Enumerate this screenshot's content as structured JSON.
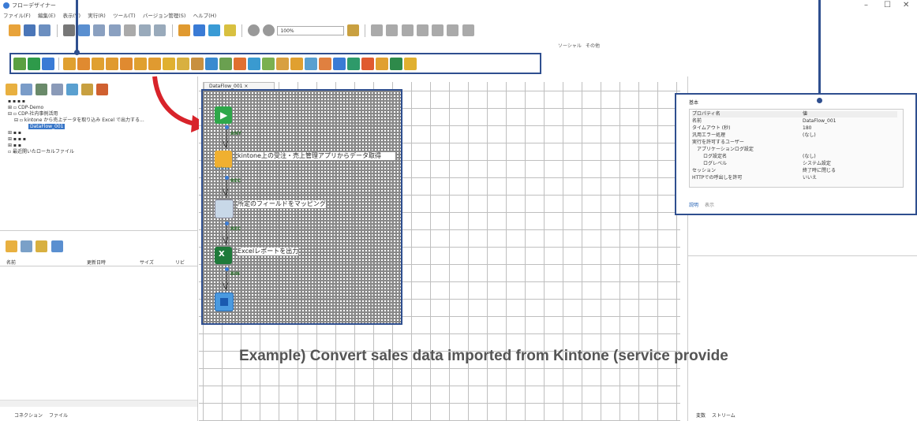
{
  "app": {
    "title": "フローデザイナー",
    "window_controls": [
      "–",
      "☐",
      "✕"
    ]
  },
  "menu": [
    "ファイル(F)",
    "編集(E)",
    "表示(V)",
    "実行(R)",
    "ツール(T)",
    "バージョン管理(S)",
    "ヘルプ(H)"
  ],
  "toolbar": {
    "zoom_value": "100%"
  },
  "component_tabs_right": [
    "ソーシャル",
    "その他"
  ],
  "left_panel": {
    "tree": {
      "items": [
        "CDP-Demo",
        "CDP-社内事例活用",
        "kintone から売上データを取り込み Excel で出力する...",
        "DataFlow_001",
        "最近開いたローカルファイル"
      ]
    },
    "file_table": {
      "columns": [
        "名前",
        "更新日時",
        "サイズ",
        "リビ"
      ]
    },
    "bottom_tabs": [
      "コネクション",
      "ファイル"
    ]
  },
  "editor": {
    "tab_label": "DataFlow_001",
    "flow": {
      "nodes": [
        {
          "label": ""
        },
        {
          "label": "kintone上の受注・売上管理アプリからデータ取得",
          "sublabel": "kintone"
        },
        {
          "label": "所定のフィールドをマッピング"
        },
        {
          "label": "Excelレポートを出力"
        },
        {
          "label": ""
        }
      ],
      "connectors": [
        "ANY",
        "REC",
        "REC",
        "BIN"
      ]
    }
  },
  "properties": {
    "tab": "基本",
    "header": {
      "key": "プロパティ名",
      "value": "値"
    },
    "rows": [
      {
        "key": "名前",
        "value": "DataFlow_001"
      },
      {
        "key": "タイムアウト (秒)",
        "value": "180"
      },
      {
        "key": "汎用エラー処理",
        "value": "(なし)"
      },
      {
        "key": "実行を許可するユーザー",
        "value": ""
      },
      {
        "key": "アプリケーションログ設定",
        "value": ""
      },
      {
        "key": "ログ設定名",
        "value": "(なし)"
      },
      {
        "key": "ログレベル",
        "value": "システム設定"
      },
      {
        "key": "セッション",
        "value": "終了時に閉じる"
      },
      {
        "key": "HTTPでの呼出しを許可",
        "value": "いいえ"
      }
    ],
    "bottom_tabs": [
      "説明",
      "表示"
    ]
  },
  "right_bottom_tabs": [
    "変数",
    "ストリーム"
  ],
  "annotation": {
    "text": "Example) Convert sales data imported from Kintone (service provide"
  },
  "colors": {
    "annotation_blue": "#2f4f8f",
    "selection_blue": "#3876c8",
    "arrow_red": "#d8232a"
  }
}
